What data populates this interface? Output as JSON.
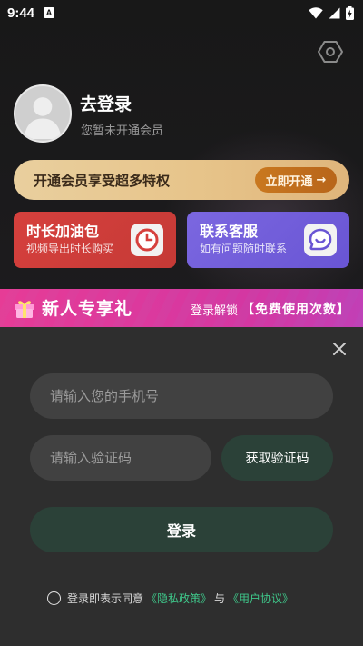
{
  "status_bar": {
    "time": "9:44",
    "notification_icon_letter": "A"
  },
  "profile": {
    "title": "去登录",
    "subtitle": "您暂未开通会员"
  },
  "vip_banner": {
    "text": "开通会员享受超多特权",
    "button_label": "立即开通",
    "button_arrow": "→"
  },
  "cards": [
    {
      "title": "时长加油包",
      "subtitle": "视频导出时长购买",
      "icon": "clock-icon"
    },
    {
      "title": "联系客服",
      "subtitle": "如有问题随时联系",
      "icon": "chat-icon"
    }
  ],
  "promo": {
    "title": "新人专享礼",
    "unlock_text": "登录解锁",
    "highlight_text": "【免费使用次数】"
  },
  "login_sheet": {
    "phone_placeholder": "请输入您的手机号",
    "code_placeholder": "请输入验证码",
    "get_code_label": "获取验证码",
    "login_label": "登录",
    "agreement_prefix": "登录即表示同意",
    "privacy_link": "《隐私政策》",
    "and_text": "与",
    "user_agreement_link": "《用户协议》"
  },
  "colors": {
    "accent_green": "#3fc78a",
    "button_dark_green": "#2b4138",
    "vip_gold": "#e7c48a",
    "card_red": "#d6403d",
    "card_purple": "#7b67e0",
    "promo_pink": "#d9369c"
  }
}
